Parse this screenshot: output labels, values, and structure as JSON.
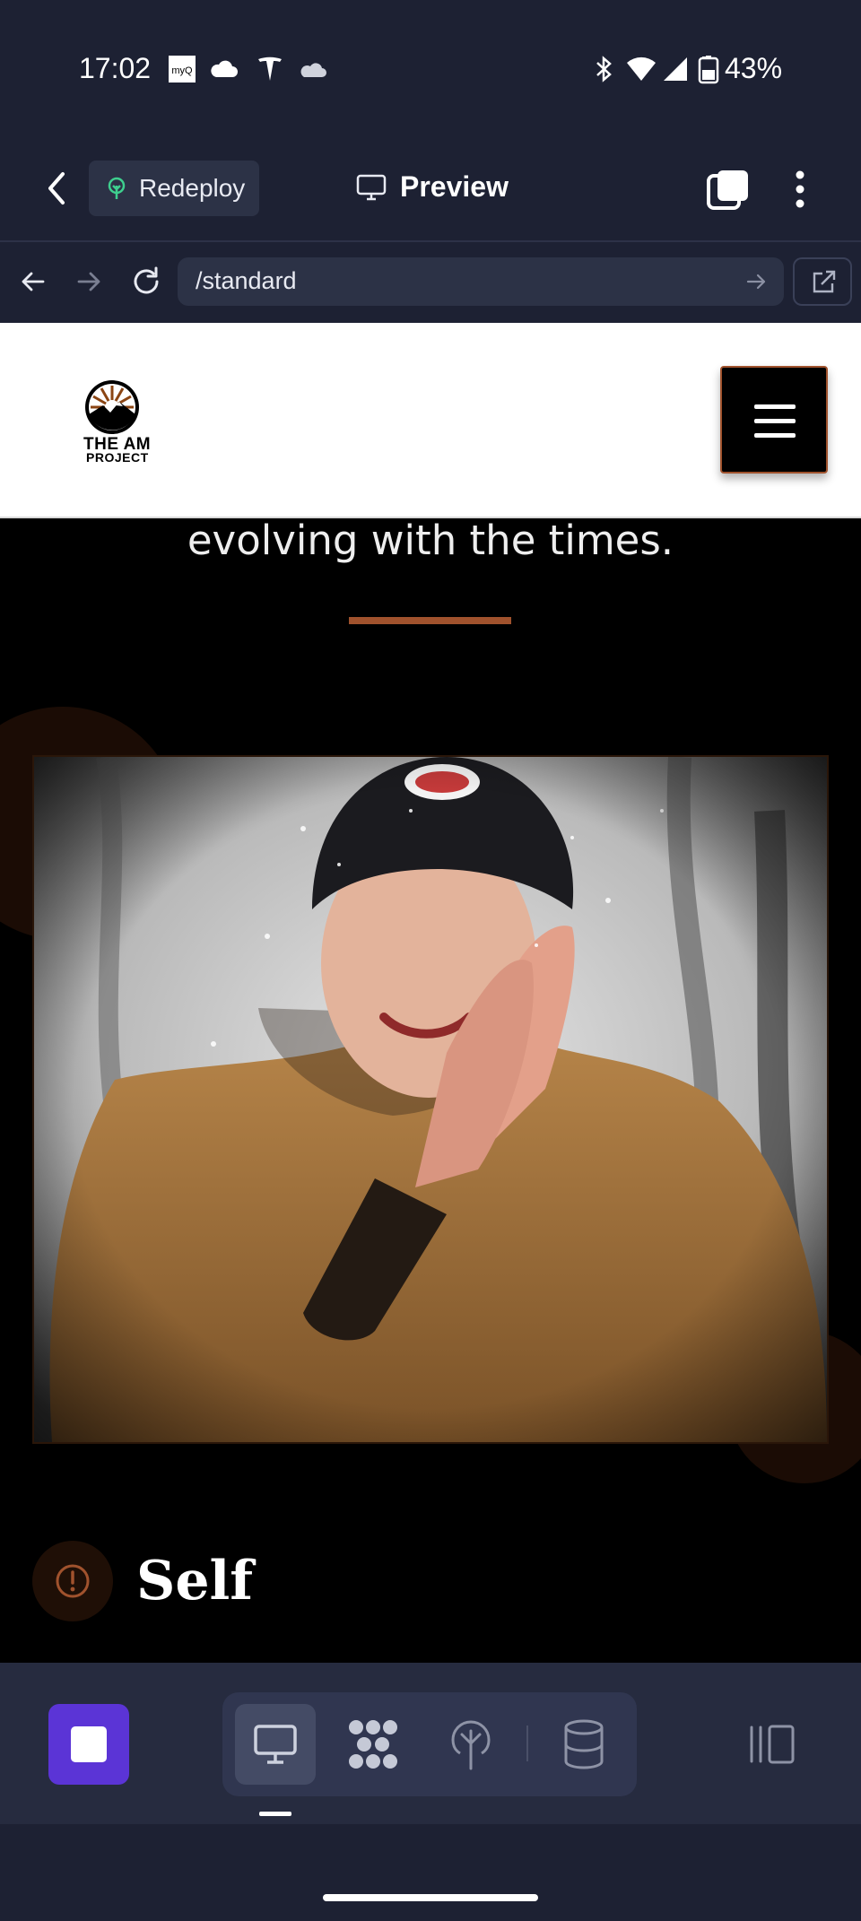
{
  "status_bar": {
    "time": "17:02",
    "left_icons": [
      "myq-icon",
      "cloud-icon",
      "tesla-icon",
      "weather-cloud-icon"
    ],
    "right_icons": [
      "bluetooth-icon",
      "wifi-icon",
      "cellular-signal-icon",
      "battery-icon"
    ],
    "battery": "43%"
  },
  "toolbar": {
    "redeploy_label": "Redeploy",
    "preview_label": "Preview"
  },
  "url_bar": {
    "path": "/standard"
  },
  "site": {
    "logo_line1": "THE AM",
    "logo_line2": "PROJECT",
    "tagline": "evolving with the times.",
    "section_title": "Self",
    "accent_color": "#a0522d"
  },
  "bottom_bar": {
    "tabs": [
      "preview-tab",
      "canvas-tab",
      "deploy-tab",
      "database-tab"
    ],
    "active_tab": "preview-tab",
    "stop_color": "#5b34d6"
  }
}
